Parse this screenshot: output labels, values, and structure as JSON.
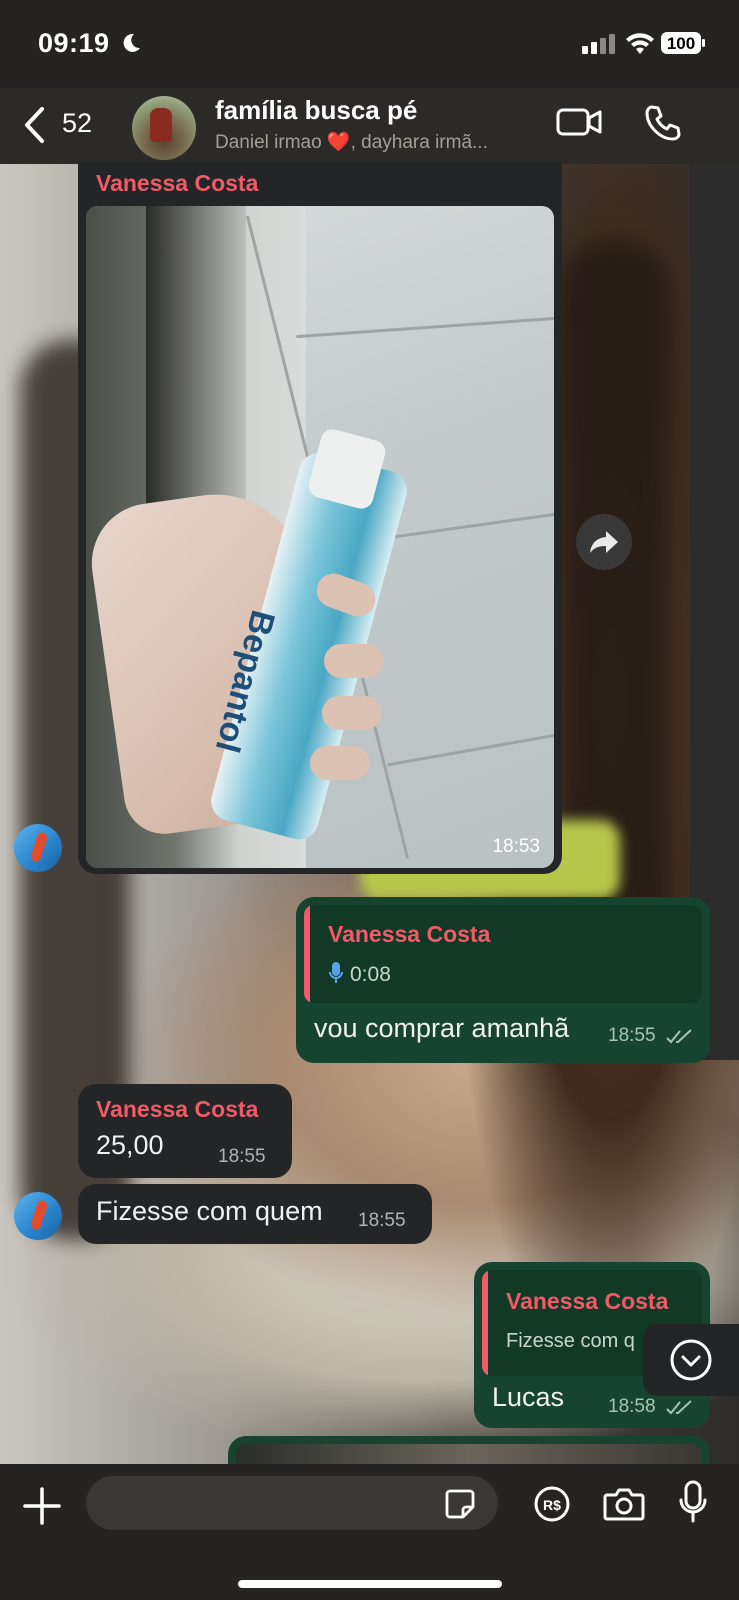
{
  "status": {
    "time": "09:19",
    "battery": "100"
  },
  "header": {
    "back_count": "52",
    "title": "família busca pé",
    "subtitle": "Daniel irmao ❤️, dayhara irmã..."
  },
  "messages": {
    "photo_message": {
      "sender": "Vanessa Costa",
      "brand_on_tube": "Bepantol",
      "time": "18:53"
    },
    "reply1": {
      "quoted_sender": "Vanessa Costa",
      "quoted_audio_duration": "0:08",
      "text": "vou comprar amanhã",
      "time": "18:55"
    },
    "msg_price": {
      "sender": "Vanessa Costa",
      "text": "25,00",
      "time": "18:55"
    },
    "msg_question": {
      "text": "Fizesse com quem",
      "time": "18:55"
    },
    "reply2": {
      "quoted_sender": "Vanessa Costa",
      "quoted_text": "Fizesse com q",
      "text": "Lucas",
      "time": "18:58"
    }
  },
  "colors": {
    "sender_name": "#ef5b66",
    "incoming_bubble": "#242527",
    "outgoing_bubble": "#174430",
    "header_bg": "#2c2a27"
  },
  "icons": [
    "back-chevron-icon",
    "video-call-icon",
    "phone-call-icon",
    "forward-icon",
    "scroll-down-icon",
    "plus-icon",
    "sticker-icon",
    "payment-icon",
    "camera-icon",
    "microphone-icon",
    "mic-small-icon",
    "double-check-icon"
  ]
}
